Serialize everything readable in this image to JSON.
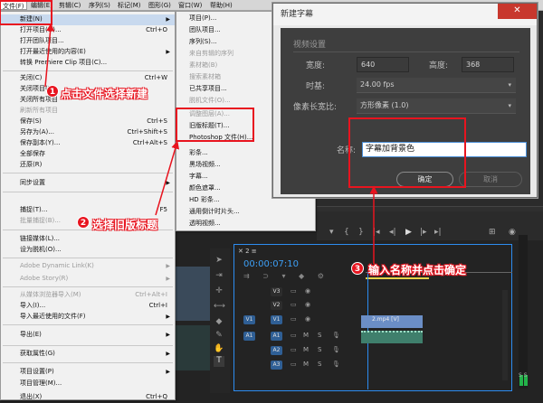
{
  "menubar": {
    "items": [
      "文件(F)",
      "编辑(E)",
      "剪辑(C)",
      "序列(S)",
      "标记(M)",
      "图形(G)",
      "窗口(W)",
      "帮助(H)"
    ]
  },
  "file_menu": {
    "new": "新建(N)",
    "open_project": "打开项目(O)...",
    "open_project_sc": "Ctrl+O",
    "open_team": "打开团队项目...",
    "open_recent": "打开最近使用的内容(E)",
    "convert_clip": "转换 Premiere Clip 项目(C)...",
    "close": "关闭(C)",
    "close_sc": "Ctrl+W",
    "close_proj": "关闭项目(P)",
    "close_all": "关闭所有项目",
    "refresh_all": "刷新所有项目",
    "save": "保存(S)",
    "save_sc": "Ctrl+S",
    "save_as": "另存为(A)...",
    "save_as_sc": "Ctrl+Shift+S",
    "save_copy": "保存副本(Y)...",
    "save_copy_sc": "Ctrl+Alt+S",
    "save_all": "全部保存",
    "revert": "还原(R)",
    "sync": "同步设置",
    "capture": "捕捉(T)...",
    "capture_sc": "F5",
    "batch_capture": "批量捕捉(B)...",
    "link_media": "链接媒体(L)...",
    "set_offline": "设为脱机(O)...",
    "dynamic_link": "Adobe Dynamic Link(K)",
    "adobe_story": "Adobe Story(R)",
    "import_browser": "从媒体浏览器导入(M)",
    "import_browser_sc": "Ctrl+Alt+I",
    "import": "导入(I)...",
    "import_sc": "Ctrl+I",
    "import_recent": "导入最近使用的文件(F)",
    "export": "导出(E)",
    "get_props": "获取属性(G)",
    "proj_settings": "项目设置(P)",
    "proj_manage": "项目管理(M)...",
    "exit": "退出(X)",
    "exit_sc": "Ctrl+Q"
  },
  "new_submenu": {
    "items": [
      "项目(P)...",
      "团队项目...",
      "序列(S)...",
      "来自剪辑的序列",
      "素材箱(B)",
      "搜索素材箱",
      "已共享项目...",
      "脱机文件(O)...",
      "调整图层(A)...",
      "旧版标题(T)...",
      "Photoshop 文件(H)...",
      "彩条...",
      "黑场视频...",
      "字幕...",
      "颜色遮罩...",
      "HD 彩条...",
      "通用倒计时片头...",
      "透明视频..."
    ]
  },
  "dialog": {
    "title": "新建字幕",
    "close": "✕",
    "video_settings": "视频设置",
    "width_label": "宽度:",
    "width_value": "640",
    "height_label": "高度:",
    "height_value": "368",
    "timebase_label": "时基:",
    "timebase_value": "24.00 fps",
    "pixel_aspect_label": "像素长宽比:",
    "pixel_aspect_value": "方形像素 (1.0)",
    "name_label": "名称:",
    "name_value": "字幕加背景色",
    "ok": "确定",
    "cancel": "取消"
  },
  "annotations": {
    "step1": "点击文件选择新建",
    "step1_num": "1",
    "step2": "选择旧版标题",
    "step2_num": "2",
    "step3": "输入名称并点击确定",
    "step3_num": "3"
  },
  "timeline": {
    "timecode": "00:00:07:10",
    "tracks": [
      "V3",
      "V2",
      "V1",
      "A1",
      "A2",
      "A3"
    ],
    "clip": "2.mp4 [V]",
    "m": "M",
    "s": "S"
  },
  "meter_label": "S S",
  "colors": {
    "accent": "#2d8cf0",
    "annotation": "#e8141f",
    "clip_blue": "#6b8ec6"
  }
}
